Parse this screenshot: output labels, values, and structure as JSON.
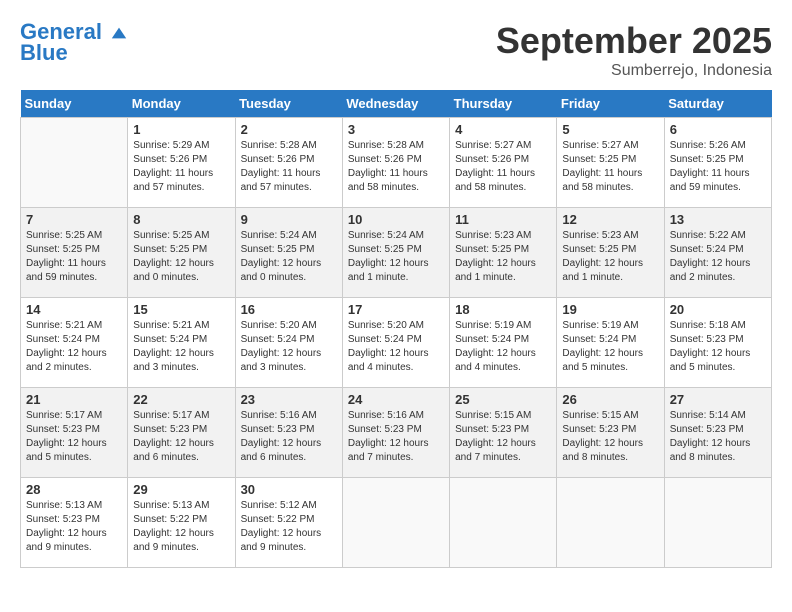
{
  "header": {
    "logo_line1": "General",
    "logo_line2": "Blue",
    "month": "September 2025",
    "location": "Sumberrejo, Indonesia"
  },
  "weekdays": [
    "Sunday",
    "Monday",
    "Tuesday",
    "Wednesday",
    "Thursday",
    "Friday",
    "Saturday"
  ],
  "weeks": [
    [
      {
        "day": "",
        "info": ""
      },
      {
        "day": "1",
        "info": "Sunrise: 5:29 AM\nSunset: 5:26 PM\nDaylight: 11 hours\nand 57 minutes."
      },
      {
        "day": "2",
        "info": "Sunrise: 5:28 AM\nSunset: 5:26 PM\nDaylight: 11 hours\nand 57 minutes."
      },
      {
        "day": "3",
        "info": "Sunrise: 5:28 AM\nSunset: 5:26 PM\nDaylight: 11 hours\nand 58 minutes."
      },
      {
        "day": "4",
        "info": "Sunrise: 5:27 AM\nSunset: 5:26 PM\nDaylight: 11 hours\nand 58 minutes."
      },
      {
        "day": "5",
        "info": "Sunrise: 5:27 AM\nSunset: 5:25 PM\nDaylight: 11 hours\nand 58 minutes."
      },
      {
        "day": "6",
        "info": "Sunrise: 5:26 AM\nSunset: 5:25 PM\nDaylight: 11 hours\nand 59 minutes."
      }
    ],
    [
      {
        "day": "7",
        "info": "Sunrise: 5:25 AM\nSunset: 5:25 PM\nDaylight: 11 hours\nand 59 minutes."
      },
      {
        "day": "8",
        "info": "Sunrise: 5:25 AM\nSunset: 5:25 PM\nDaylight: 12 hours\nand 0 minutes."
      },
      {
        "day": "9",
        "info": "Sunrise: 5:24 AM\nSunset: 5:25 PM\nDaylight: 12 hours\nand 0 minutes."
      },
      {
        "day": "10",
        "info": "Sunrise: 5:24 AM\nSunset: 5:25 PM\nDaylight: 12 hours\nand 1 minute."
      },
      {
        "day": "11",
        "info": "Sunrise: 5:23 AM\nSunset: 5:25 PM\nDaylight: 12 hours\nand 1 minute."
      },
      {
        "day": "12",
        "info": "Sunrise: 5:23 AM\nSunset: 5:25 PM\nDaylight: 12 hours\nand 1 minute."
      },
      {
        "day": "13",
        "info": "Sunrise: 5:22 AM\nSunset: 5:24 PM\nDaylight: 12 hours\nand 2 minutes."
      }
    ],
    [
      {
        "day": "14",
        "info": "Sunrise: 5:21 AM\nSunset: 5:24 PM\nDaylight: 12 hours\nand 2 minutes."
      },
      {
        "day": "15",
        "info": "Sunrise: 5:21 AM\nSunset: 5:24 PM\nDaylight: 12 hours\nand 3 minutes."
      },
      {
        "day": "16",
        "info": "Sunrise: 5:20 AM\nSunset: 5:24 PM\nDaylight: 12 hours\nand 3 minutes."
      },
      {
        "day": "17",
        "info": "Sunrise: 5:20 AM\nSunset: 5:24 PM\nDaylight: 12 hours\nand 4 minutes."
      },
      {
        "day": "18",
        "info": "Sunrise: 5:19 AM\nSunset: 5:24 PM\nDaylight: 12 hours\nand 4 minutes."
      },
      {
        "day": "19",
        "info": "Sunrise: 5:19 AM\nSunset: 5:24 PM\nDaylight: 12 hours\nand 5 minutes."
      },
      {
        "day": "20",
        "info": "Sunrise: 5:18 AM\nSunset: 5:23 PM\nDaylight: 12 hours\nand 5 minutes."
      }
    ],
    [
      {
        "day": "21",
        "info": "Sunrise: 5:17 AM\nSunset: 5:23 PM\nDaylight: 12 hours\nand 5 minutes."
      },
      {
        "day": "22",
        "info": "Sunrise: 5:17 AM\nSunset: 5:23 PM\nDaylight: 12 hours\nand 6 minutes."
      },
      {
        "day": "23",
        "info": "Sunrise: 5:16 AM\nSunset: 5:23 PM\nDaylight: 12 hours\nand 6 minutes."
      },
      {
        "day": "24",
        "info": "Sunrise: 5:16 AM\nSunset: 5:23 PM\nDaylight: 12 hours\nand 7 minutes."
      },
      {
        "day": "25",
        "info": "Sunrise: 5:15 AM\nSunset: 5:23 PM\nDaylight: 12 hours\nand 7 minutes."
      },
      {
        "day": "26",
        "info": "Sunrise: 5:15 AM\nSunset: 5:23 PM\nDaylight: 12 hours\nand 8 minutes."
      },
      {
        "day": "27",
        "info": "Sunrise: 5:14 AM\nSunset: 5:23 PM\nDaylight: 12 hours\nand 8 minutes."
      }
    ],
    [
      {
        "day": "28",
        "info": "Sunrise: 5:13 AM\nSunset: 5:23 PM\nDaylight: 12 hours\nand 9 minutes."
      },
      {
        "day": "29",
        "info": "Sunrise: 5:13 AM\nSunset: 5:22 PM\nDaylight: 12 hours\nand 9 minutes."
      },
      {
        "day": "30",
        "info": "Sunrise: 5:12 AM\nSunset: 5:22 PM\nDaylight: 12 hours\nand 9 minutes."
      },
      {
        "day": "",
        "info": ""
      },
      {
        "day": "",
        "info": ""
      },
      {
        "day": "",
        "info": ""
      },
      {
        "day": "",
        "info": ""
      }
    ]
  ]
}
